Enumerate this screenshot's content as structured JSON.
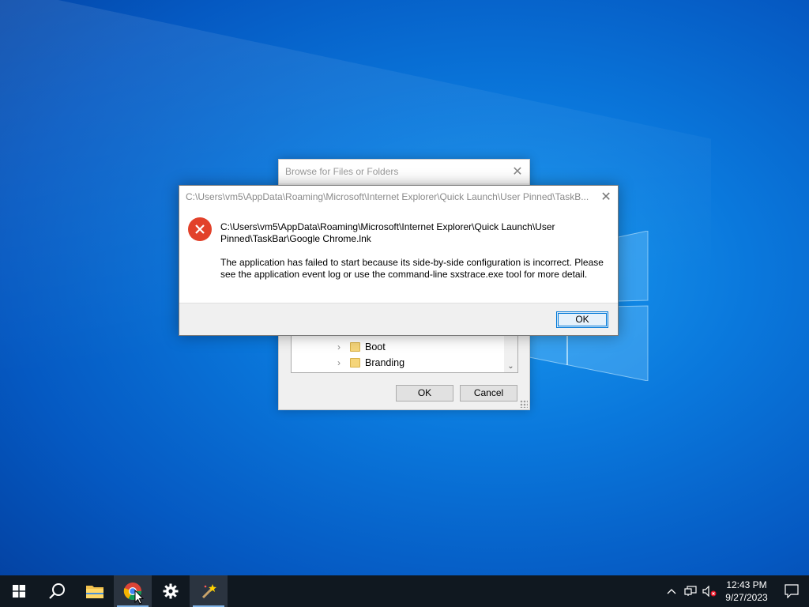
{
  "browse_dialog": {
    "title": "Browse for Files or Folders",
    "tree_items": [
      {
        "label": "Boot"
      },
      {
        "label": "Branding"
      }
    ],
    "ok_label": "OK",
    "cancel_label": "Cancel"
  },
  "error_dialog": {
    "title": "C:\\Users\\vm5\\AppData\\Roaming\\Microsoft\\Internet Explorer\\Quick Launch\\User Pinned\\TaskB...",
    "path_line_1": "C:\\Users\\vm5\\AppData\\Roaming\\Microsoft\\Internet Explorer\\Quick Launch\\User",
    "path_line_2": "Pinned\\TaskBar\\Google Chrome.lnk",
    "message_line_1": "The application has failed to start because its side-by-side configuration is incorrect. Please",
    "message_line_2": "see the application event log or use the command-line sxstrace.exe tool for more detail.",
    "ok_label": "OK",
    "icon": "error-icon",
    "accent_color": "#e2412a"
  },
  "taskbar": {
    "apps": [
      {
        "name": "start",
        "icon": "windows-icon"
      },
      {
        "name": "search",
        "icon": "search-icon"
      },
      {
        "name": "file-explorer",
        "icon": "folder-icon"
      },
      {
        "name": "chrome",
        "icon": "chrome-icon"
      },
      {
        "name": "settings",
        "icon": "gear-icon"
      },
      {
        "name": "wand-app",
        "icon": "magic-wand-icon"
      }
    ],
    "clock_time": "12:43 PM",
    "clock_date": "9/27/2023"
  }
}
